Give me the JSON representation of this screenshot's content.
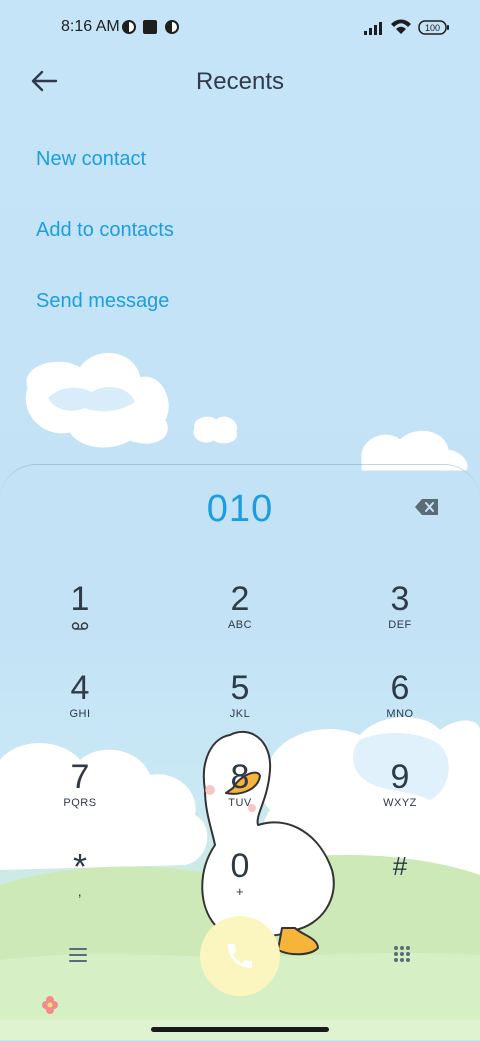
{
  "status_bar": {
    "time": "8:16 AM",
    "battery": "100"
  },
  "header": {
    "title": "Recents"
  },
  "actions": [
    "New contact",
    "Add to contacts",
    "Send message"
  ],
  "dialer": {
    "number": "010",
    "keys": [
      {
        "digit": "1",
        "sub": ""
      },
      {
        "digit": "2",
        "sub": "ABC"
      },
      {
        "digit": "3",
        "sub": "DEF"
      },
      {
        "digit": "4",
        "sub": "GHI"
      },
      {
        "digit": "5",
        "sub": "JKL"
      },
      {
        "digit": "6",
        "sub": "MNO"
      },
      {
        "digit": "7",
        "sub": "PQRS"
      },
      {
        "digit": "8",
        "sub": "TUV"
      },
      {
        "digit": "9",
        "sub": "WXYZ"
      },
      {
        "digit": "*",
        "sub": ","
      },
      {
        "digit": "0",
        "sub": "+"
      },
      {
        "digit": "#",
        "sub": ""
      }
    ]
  },
  "icons": {
    "back": "arrow-left-icon",
    "backspace": "backspace-icon",
    "voicemail": "voicemail-icon",
    "menu": "menu-icon",
    "call": "phone-icon",
    "keypad": "dialpad-icon"
  },
  "colors": {
    "accent": "#1c9de0",
    "call_button": "#fbf6c0",
    "text": "#2e3a46"
  }
}
